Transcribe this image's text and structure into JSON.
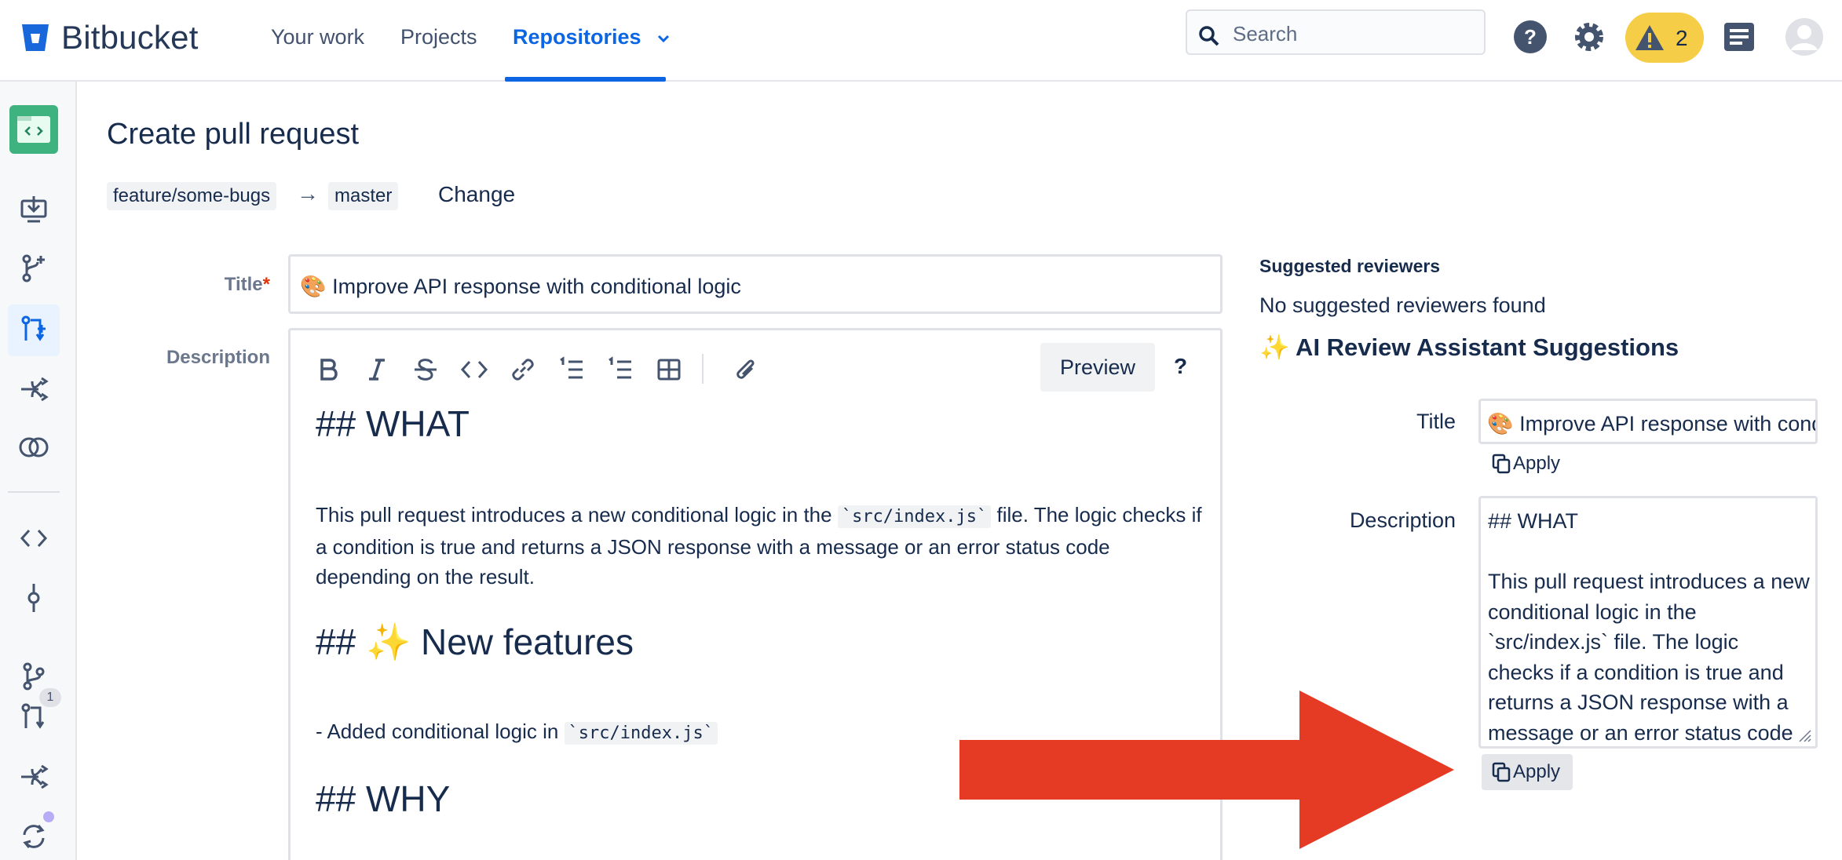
{
  "app": {
    "name": "Bitbucket"
  },
  "nav": {
    "items": [
      {
        "label": "Your work"
      },
      {
        "label": "Projects"
      },
      {
        "label": "Repositories"
      }
    ]
  },
  "search": {
    "placeholder": "Search"
  },
  "header_icons": [
    "help-icon",
    "settings-icon",
    "warning-icon",
    "notes-icon",
    "avatar"
  ],
  "warnings": {
    "count": "2"
  },
  "sidebar": {
    "badge": "1",
    "icons": [
      "repo-icon",
      "clone-icon",
      "branch-create-icon",
      "pull-request-icon",
      "deploy-icon",
      "compare-icon",
      "source-icon",
      "commits-icon",
      "branches-icon",
      "pull-requests-icon",
      "pipelines-icon",
      "sync-icon"
    ]
  },
  "page": {
    "title": "Create pull request",
    "source_branch": "feature/some-bugs",
    "arrow": "→",
    "target_branch": "master",
    "change_label": "Change"
  },
  "form": {
    "title_label": "Title",
    "required_mark": "*",
    "title_value": "🎨 Improve API response with conditional logic",
    "description_label": "Description",
    "preview_label": "Preview",
    "help_label": "?",
    "toolbar": [
      "bold-icon",
      "italic-icon",
      "strikethrough-icon",
      "code-icon",
      "link-icon",
      "ordered-list-icon",
      "bullet-list-icon",
      "table-icon",
      "attachment-icon"
    ],
    "md_what": "## WHAT",
    "md_p1_a": "This pull request introduces a new conditional logic in the ",
    "md_p1_code": "`src/index.js`",
    "md_p1_b": " file. The logic checks if a condition is true and returns a JSON response with a message or an error status code depending on the result.",
    "md_new_features": "## ✨ New features",
    "md_li_a": "- Added conditional logic in ",
    "md_li_code": "`src/index.js`",
    "md_why": "## WHY"
  },
  "right_panel": {
    "reviewers_heading": "Suggested reviewers",
    "reviewers_none": "No suggested reviewers found",
    "ai_heading": "✨ AI Review Assistant Suggestions",
    "title_label": "Title",
    "title_value": "🎨 Improve API response with conditional logic",
    "apply_label": "Apply",
    "description_label": "Description",
    "description_value": "## WHAT\n\nThis pull request introduces a new conditional logic in the `src/index.js` file. The logic checks if a condition is true and returns a JSON response with a message or an error status code"
  },
  "colors": {
    "accent": "#0c66e4",
    "warning_pill": "#f5cd47",
    "repo_avatar": "#3fb37f",
    "annotation_arrow": "#e53b24"
  }
}
